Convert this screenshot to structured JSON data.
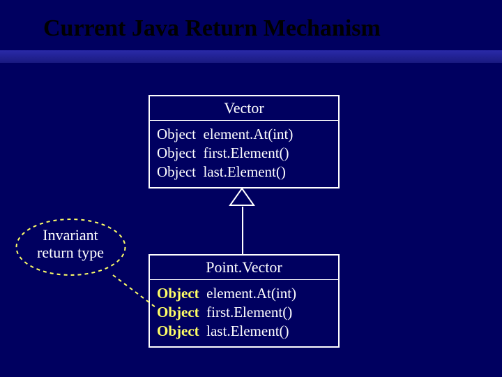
{
  "title": "Current Java Return Mechanism",
  "callout": {
    "line1": "Invariant",
    "line2": "return type"
  },
  "vector": {
    "name": "Vector",
    "rows": [
      {
        "ret": "Object",
        "sig": "element.At(int)"
      },
      {
        "ret": "Object",
        "sig": "first.Element()"
      },
      {
        "ret": "Object",
        "sig": "last.Element()"
      }
    ]
  },
  "pointVector": {
    "name": "Point.Vector",
    "rows": [
      {
        "ret": "Object",
        "sig": "element.At(int)"
      },
      {
        "ret": "Object",
        "sig": "first.Element()"
      },
      {
        "ret": "Object",
        "sig": "last.Element()"
      }
    ]
  }
}
